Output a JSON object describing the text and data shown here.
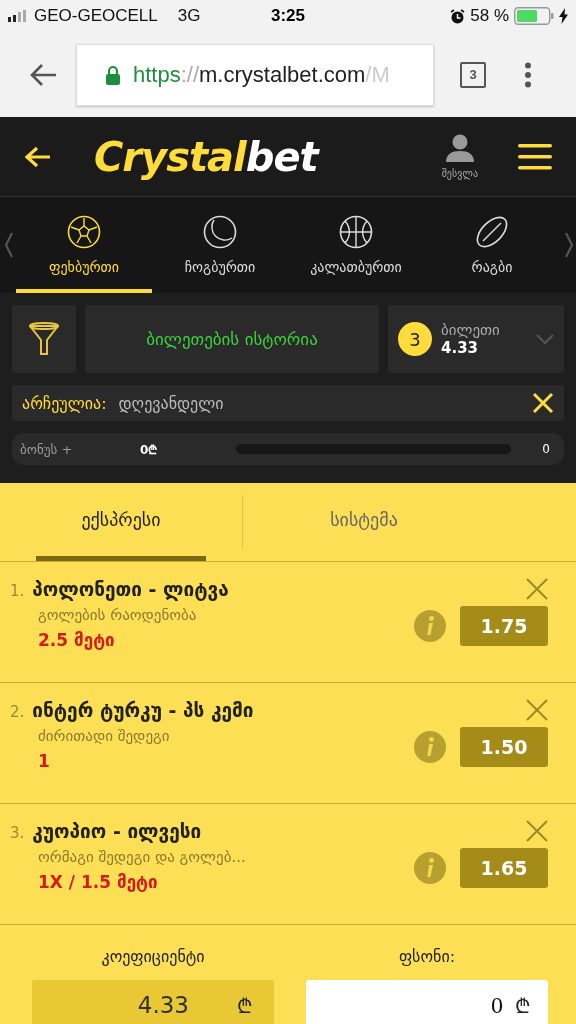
{
  "status_bar": {
    "carrier": "GEO-GEOCELL",
    "network": "3G",
    "time": "3:25",
    "battery": "58 %"
  },
  "browser": {
    "url_scheme": "https",
    "url_separator": "://",
    "url_host": "m.crystalbet.com",
    "url_tail": "/M",
    "tab_count": "3"
  },
  "header": {
    "logo_first": "Crystal",
    "logo_second": "bet",
    "login": "შესვლა"
  },
  "sports": [
    {
      "label": "ფეხბურთი",
      "kind": "soccer",
      "selected": true
    },
    {
      "label": "ჩოგბურთი",
      "kind": "tennis",
      "selected": false
    },
    {
      "label": "კალათბურთი",
      "kind": "basketball",
      "selected": false
    },
    {
      "label": "რაგბი",
      "kind": "rugby",
      "selected": false
    }
  ],
  "toolbar": {
    "history": "ბილეთების ისტორია",
    "ticket_count": "3",
    "ticket_label": "ბილეთი",
    "ticket_odds": "4.33"
  },
  "filter": {
    "label": "არჩეულია:",
    "value": "დღევანდელი"
  },
  "bonus": {
    "label": "ბონუს +",
    "amount": "0₾",
    "count": "0"
  },
  "slip_tabs": [
    {
      "label": "ექსპრესი",
      "selected": true
    },
    {
      "label": "სისტემა",
      "selected": false
    }
  ],
  "bets": [
    {
      "number": "1.",
      "title": "პოლონეთი - ლიტვა",
      "market": "გოლების რაოდენობა",
      "selection": "2.5 მეტი",
      "odds": "1.75"
    },
    {
      "number": "2.",
      "title": "ინტერ ტურკუ - პს კემი",
      "market": "ძირითადი შედეგი",
      "selection": "1",
      "odds": "1.50"
    },
    {
      "number": "3.",
      "title": "კუოპიო - ილვესი",
      "market": "ორმაგი შედეგი და გოლებ...",
      "selection": "1X / 1.5 მეტი",
      "odds": "1.65"
    }
  ],
  "summary": {
    "coef_label": "კოეფიციენტი",
    "coef_value": "4.33",
    "coef_currency": "₾",
    "stake_label": "ფსონი:",
    "stake_value": "0",
    "stake_currency": "₾"
  }
}
